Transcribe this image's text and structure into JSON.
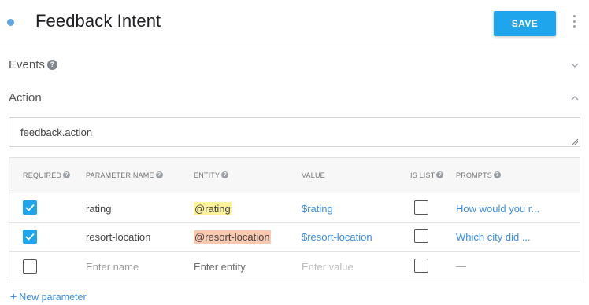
{
  "header": {
    "title": "Feedback Intent",
    "save_label": "SAVE"
  },
  "sections": {
    "events_label": "Events",
    "action_label": "Action"
  },
  "action": {
    "value": "feedback.action"
  },
  "table": {
    "headers": {
      "required": "REQUIRED",
      "parameter_name": "PARAMETER NAME",
      "entity": "ENTITY",
      "value": "VALUE",
      "is_list": "IS LIST",
      "prompts": "PROMPTS"
    },
    "rows": [
      {
        "required": true,
        "name": "rating",
        "entity": "@rating",
        "entity_highlight": "#fdf29a",
        "value": "$rating",
        "is_list": false,
        "prompts": "How would you r..."
      },
      {
        "required": true,
        "name": "resort-location",
        "entity": "@resort-location",
        "entity_highlight": "#fbc8b0",
        "value": "$resort-location",
        "is_list": false,
        "prompts": "Which city did ..."
      }
    ],
    "new_row": {
      "required": false,
      "name_placeholder": "Enter name",
      "entity_placeholder": "Enter entity",
      "value_placeholder": "Enter value",
      "is_list": false,
      "prompts": "—"
    }
  },
  "footer": {
    "new_parameter_label": "New parameter"
  },
  "colors": {
    "accent": "#1fa5ec",
    "link": "#3a8ee6"
  },
  "icons": [
    "status-dot",
    "more-vert-icon",
    "help-icon",
    "chevron-down-icon",
    "chevron-up-icon",
    "checkbox-checked-icon",
    "plus-icon"
  ]
}
